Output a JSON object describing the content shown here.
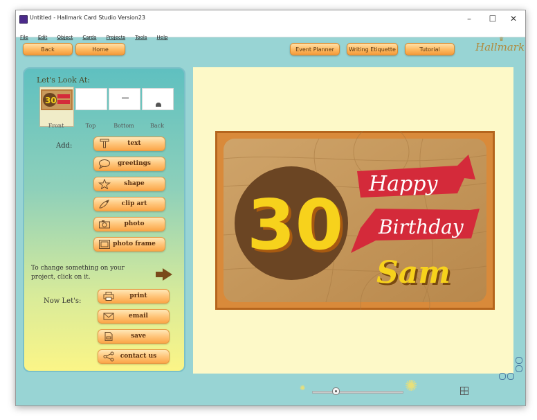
{
  "window": {
    "title": "Untitled - Hallmark Card Studio Version23",
    "controls": {
      "minimize": "–",
      "maximize": "☐",
      "close": "✕"
    }
  },
  "menu": [
    "File",
    "Edit",
    "Object",
    "Cards",
    "Projects",
    "Tools",
    "Help"
  ],
  "toolbar": {
    "back": "Back",
    "home": "Home",
    "event_planner": "Event Planner",
    "writing_etiquette": "Writing Etiquette",
    "tutorial": "Tutorial",
    "logo": "Hallmark"
  },
  "left_panel": {
    "look_at_title": "Let's Look At:",
    "views": [
      "Front",
      "Top",
      "Bottom",
      "Back"
    ],
    "add_label": "Add:",
    "add_actions": [
      {
        "label": "text",
        "icon": "text-icon"
      },
      {
        "label": "greetings",
        "icon": "speech-bubble-icon"
      },
      {
        "label": "shape",
        "icon": "star-icon"
      },
      {
        "label": "clip art",
        "icon": "clip-art-icon"
      },
      {
        "label": "photo",
        "icon": "camera-icon"
      },
      {
        "label": "photo frame",
        "icon": "photo-frame-icon"
      }
    ],
    "hint": "To change something on your project, click on it.",
    "now_lets_label": "Now Let's:",
    "finish_actions": [
      {
        "label": "print",
        "icon": "printer-icon"
      },
      {
        "label": "email",
        "icon": "envelope-icon"
      },
      {
        "label": "save",
        "icon": "save-icon"
      },
      {
        "label": "contact us",
        "icon": "share-icon"
      }
    ]
  },
  "card": {
    "number": "30",
    "line1": "Happy",
    "line2": "Birthday",
    "name": "Sam"
  },
  "colors": {
    "window_bg": "#98d4d4",
    "canvas_bg": "#fdf9c8",
    "button_orange": "#fba648",
    "ribbon_red": "#d42a3a",
    "number_yellow": "#f7d21c"
  },
  "zoom": {
    "level": 0.1
  }
}
